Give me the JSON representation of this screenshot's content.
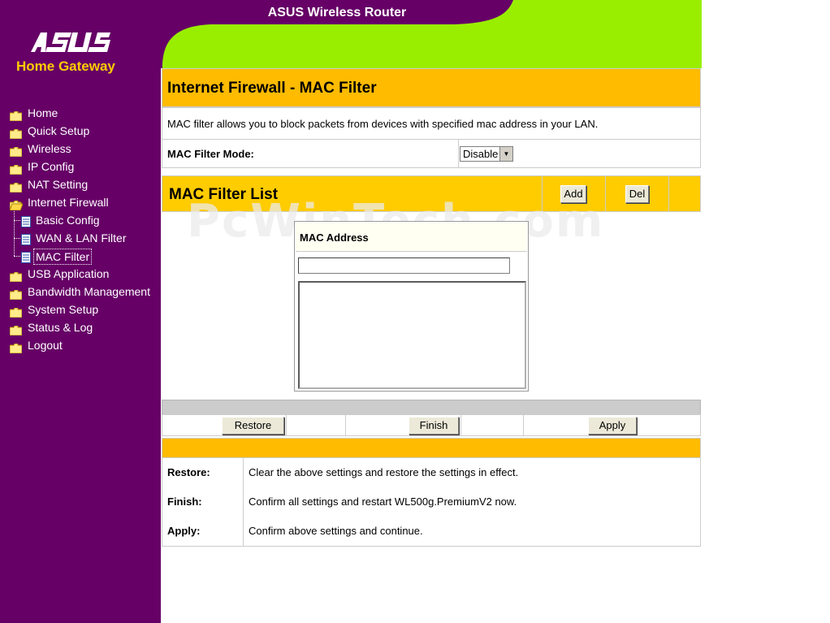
{
  "header": {
    "title": "ASUS Wireless Router",
    "logo_text": "/ISUS",
    "subtitle": "Home Gateway"
  },
  "sidebar": {
    "items": [
      {
        "label": "Home",
        "icon": "folder-icon"
      },
      {
        "label": "Quick Setup",
        "icon": "folder-icon"
      },
      {
        "label": "Wireless",
        "icon": "folder-icon"
      },
      {
        "label": "IP Config",
        "icon": "folder-icon"
      },
      {
        "label": "NAT Setting",
        "icon": "folder-icon"
      },
      {
        "label": "Internet Firewall",
        "icon": "folder-open-icon"
      },
      {
        "label": "Basic Config",
        "icon": "page-icon"
      },
      {
        "label": "WAN & LAN Filter",
        "icon": "page-icon"
      },
      {
        "label": "MAC Filter",
        "icon": "page-icon",
        "active": true
      },
      {
        "label": "USB Application",
        "icon": "folder-icon"
      },
      {
        "label": "Bandwidth Management",
        "icon": "folder-icon"
      },
      {
        "label": "System Setup",
        "icon": "folder-icon"
      },
      {
        "label": "Status & Log",
        "icon": "folder-icon"
      },
      {
        "label": "Logout",
        "icon": "folder-icon"
      }
    ]
  },
  "main": {
    "page_title": "Internet Firewall - MAC Filter",
    "description": "MAC filter allows you to block packets from devices with specified mac address in your LAN.",
    "mode": {
      "label": "MAC Filter Mode:",
      "value": "Disable"
    },
    "list": {
      "title": "MAC Filter List",
      "add_label": "Add",
      "del_label": "Del",
      "column_header": "MAC Address",
      "input_value": ""
    },
    "actions": {
      "restore": "Restore",
      "finish": "Finish",
      "apply": "Apply"
    },
    "help": [
      {
        "key": "Restore:",
        "text": "Clear the above settings and restore the settings in effect."
      },
      {
        "key": "Finish:",
        "text": "Confirm all settings and restart WL500g.PremiumV2 now."
      },
      {
        "key": "Apply:",
        "text": "Confirm above settings and continue."
      }
    ]
  },
  "watermark": "PcWinTech.com",
  "colors": {
    "sidebar": "#660066",
    "header_green": "#99ee00",
    "title_orange": "#ffbb00",
    "list_yellow": "#ffcc00",
    "subtitle_gold": "#ffcc00"
  }
}
